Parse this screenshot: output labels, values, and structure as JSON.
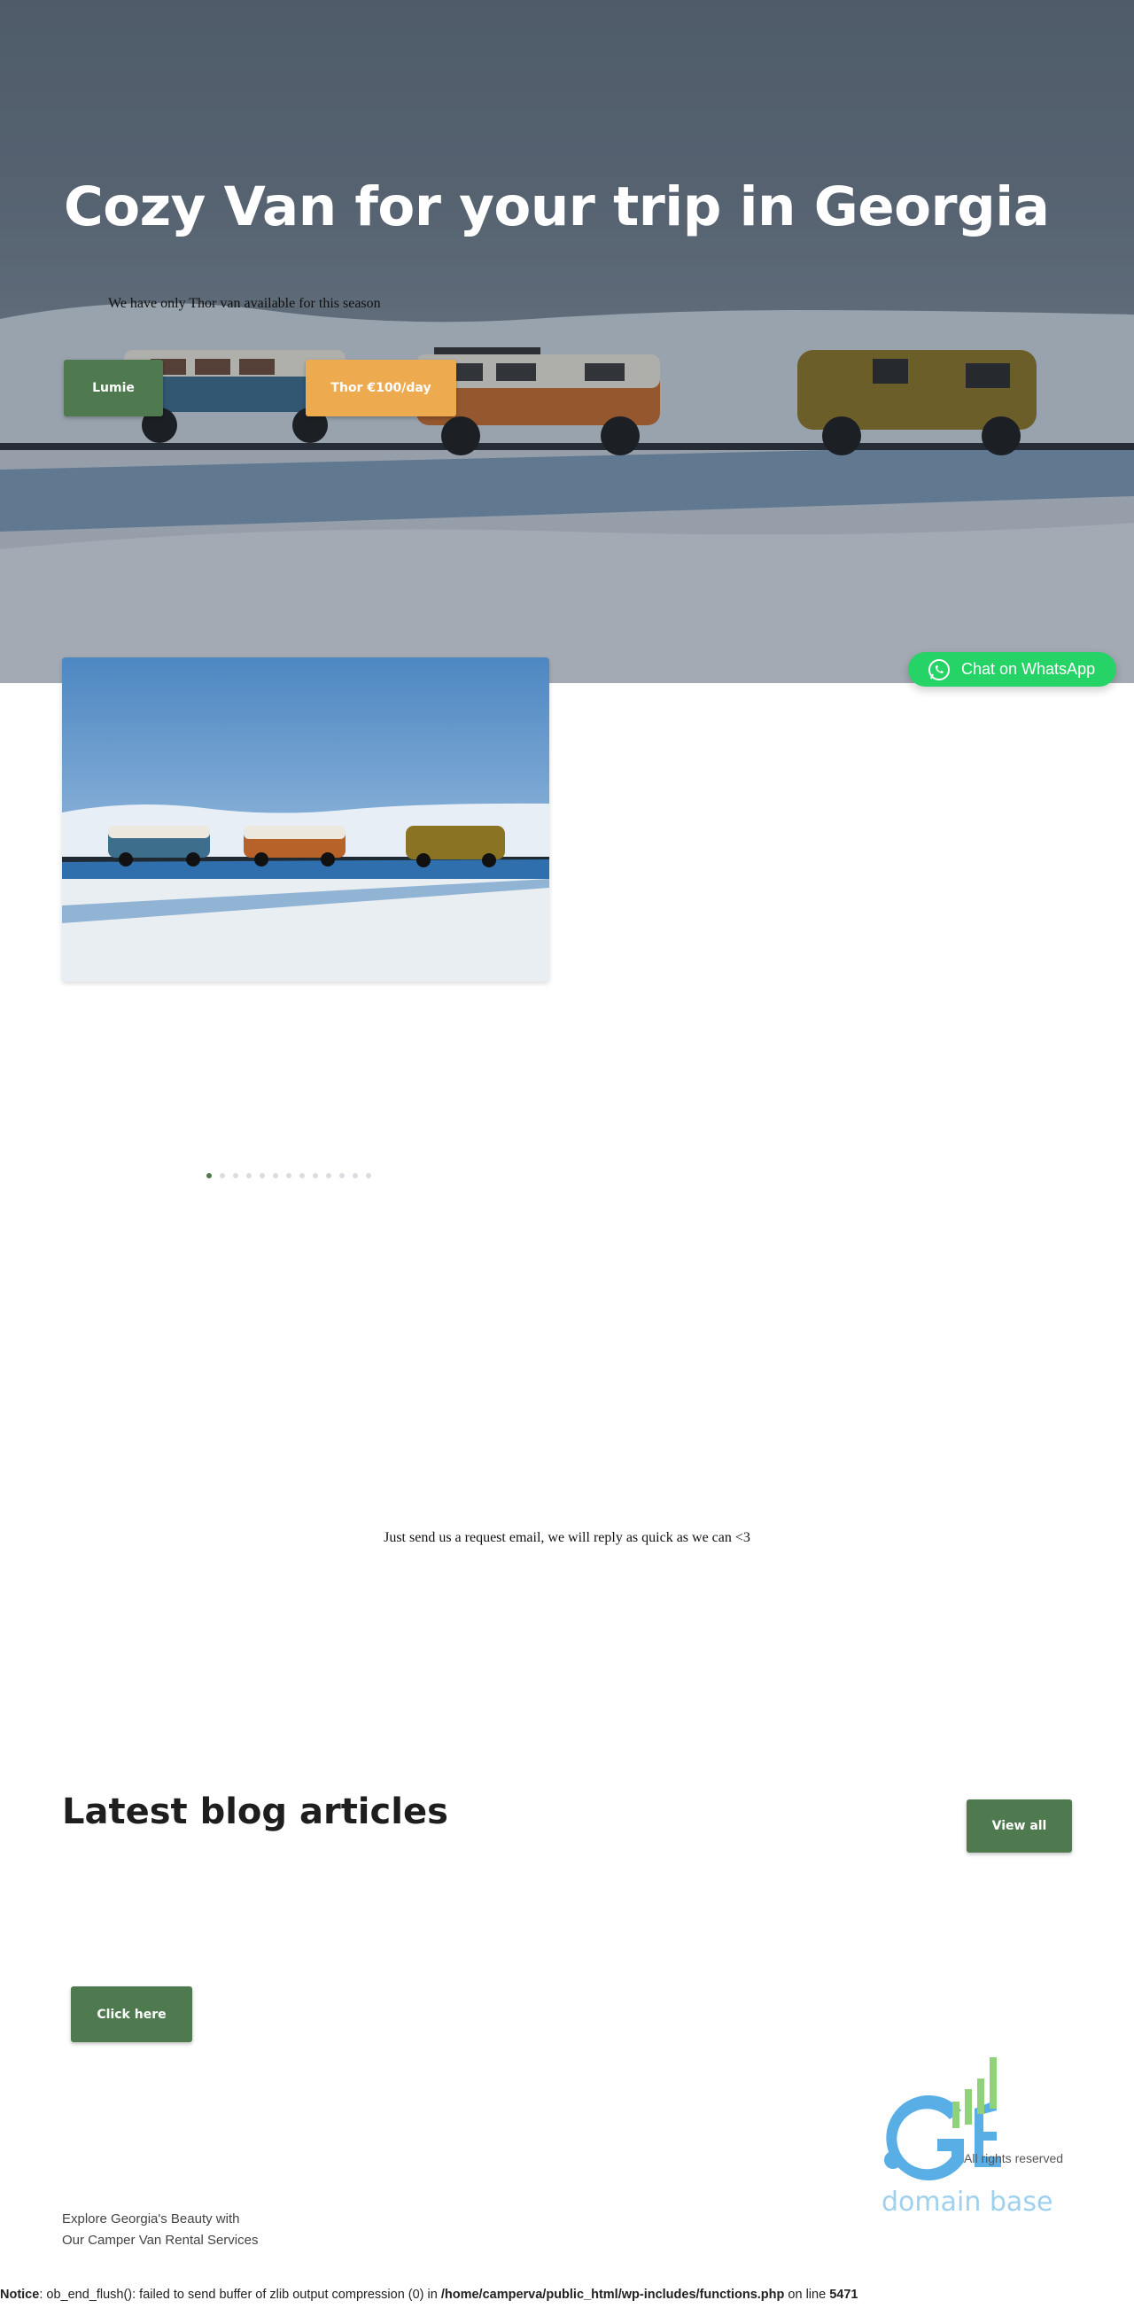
{
  "hero": {
    "title": "Cozy Van for your trip in Georgia",
    "subtitle": "We have only Thor van available for this season",
    "buttons": {
      "lumie": "Lumie",
      "thor": "Thor €100/day"
    }
  },
  "whatsapp": {
    "label": "Chat on WhatsApp",
    "color": "#25d366"
  },
  "slider": {
    "dot_count": 13,
    "active_index": 0
  },
  "contact": {
    "text": "Just send us a request email, we will reply as quick as we can <3"
  },
  "blog": {
    "title": "Latest blog articles",
    "view_all": "View all"
  },
  "cta": {
    "label": "Click here"
  },
  "footer": {
    "logo_text": "domain base",
    "rights": "All rights reserved",
    "tagline_line1": "Explore Georgia's Beauty with",
    "tagline_line2": "Our Camper Van Rental Services"
  },
  "notice": {
    "label": "Notice",
    "message": ": ob_end_flush(): failed to send buffer of zlib output compression (0) in ",
    "path": "/home/camperva/public_html/wp-includes/functions.php",
    "on_line": " on line ",
    "line": "5471"
  },
  "colors": {
    "brand_green": "#4f7a4f",
    "accent_orange": "#eeaa4e",
    "logo_blue": "#5aaee6"
  }
}
